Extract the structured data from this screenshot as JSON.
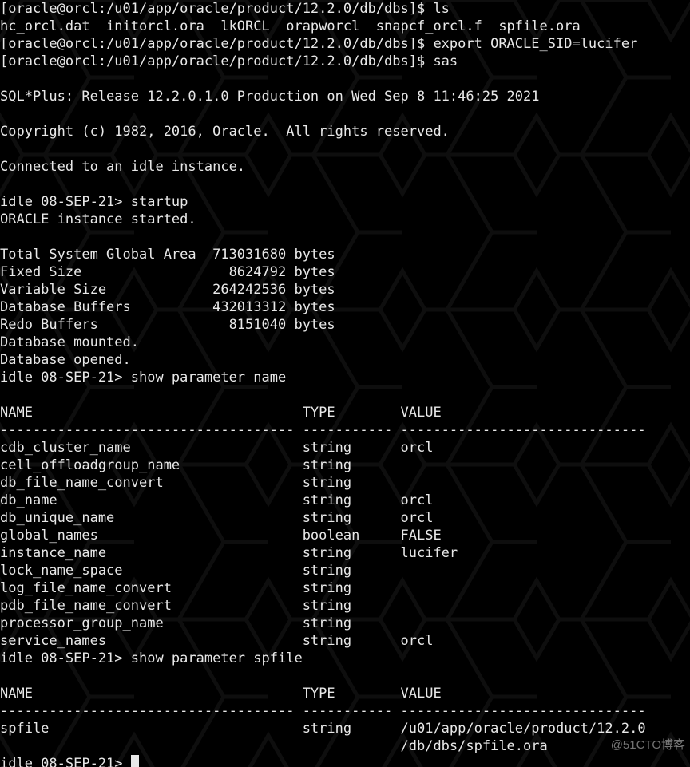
{
  "shell": {
    "prompt": "[oracle@orcl:/u01/app/oracle/product/12.2.0/db/dbs]$ ",
    "cmd_ls": "ls",
    "ls_output": "hc_orcl.dat  initorcl.ora  lkORCL  orapworcl  snapcf_orcl.f  spfile.ora",
    "cmd_export": "export ORACLE_SID=lucifer",
    "cmd_sas": "sas"
  },
  "sqlplus": {
    "banner1": "SQL*Plus: Release 12.2.0.1.0 Production on Wed Sep 8 11:46:25 2021",
    "copyright": "Copyright (c) 1982, 2016, Oracle.  All rights reserved.",
    "connected": "Connected to an idle instance.",
    "prompt": "idle 08-SEP-21> ",
    "cmd_startup": "startup",
    "startup_msg": "ORACLE instance started.",
    "sga_rows": [
      {
        "label": "Total System Global Area",
        "value": "713031680",
        "unit": "bytes"
      },
      {
        "label": "Fixed Size",
        "value": "8624792",
        "unit": "bytes"
      },
      {
        "label": "Variable Size",
        "value": "264242536",
        "unit": "bytes"
      },
      {
        "label": "Database Buffers",
        "value": "432013312",
        "unit": "bytes"
      },
      {
        "label": "Redo Buffers",
        "value": "8151040",
        "unit": "bytes"
      }
    ],
    "db_mounted": "Database mounted.",
    "db_opened": "Database opened.",
    "cmd_show_name": "show parameter name",
    "headers": {
      "name": "NAME",
      "type": "TYPE",
      "value": "VALUE"
    },
    "sep": {
      "name": "------------------------------------",
      "type": "-----------",
      "value": "------------------------------"
    },
    "params_name": [
      {
        "name": "cdb_cluster_name",
        "type": "string",
        "value": "orcl"
      },
      {
        "name": "cell_offloadgroup_name",
        "type": "string",
        "value": ""
      },
      {
        "name": "db_file_name_convert",
        "type": "string",
        "value": ""
      },
      {
        "name": "db_name",
        "type": "string",
        "value": "orcl"
      },
      {
        "name": "db_unique_name",
        "type": "string",
        "value": "orcl"
      },
      {
        "name": "global_names",
        "type": "boolean",
        "value": "FALSE"
      },
      {
        "name": "instance_name",
        "type": "string",
        "value": "lucifer"
      },
      {
        "name": "lock_name_space",
        "type": "string",
        "value": ""
      },
      {
        "name": "log_file_name_convert",
        "type": "string",
        "value": ""
      },
      {
        "name": "pdb_file_name_convert",
        "type": "string",
        "value": ""
      },
      {
        "name": "processor_group_name",
        "type": "string",
        "value": ""
      },
      {
        "name": "service_names",
        "type": "string",
        "value": "orcl"
      }
    ],
    "cmd_show_spfile": "show parameter spfile",
    "params_spfile_wrap": [
      {
        "name": "spfile",
        "type": "string",
        "value": "/u01/app/oracle/product/12.2.0"
      },
      {
        "name": "",
        "type": "",
        "value": "/db/dbs/spfile.ora"
      }
    ]
  },
  "watermark": "@51CTO博客",
  "colors": {
    "bg": "#000000",
    "fg": "#e8e8e8",
    "hex": "#2a2a2a"
  }
}
